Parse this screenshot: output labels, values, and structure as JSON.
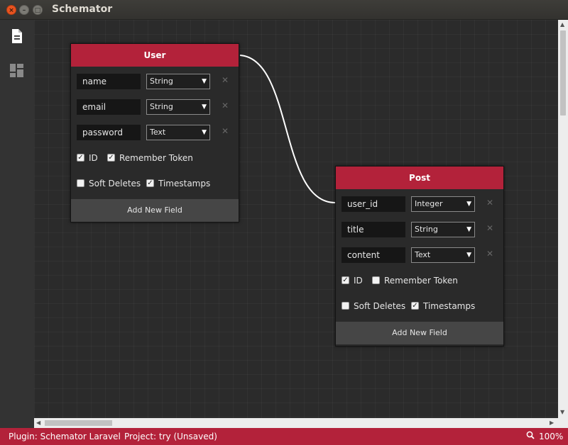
{
  "window": {
    "title": "Schemator",
    "close_glyph": "×",
    "min_glyph": "–",
    "max_glyph": "□"
  },
  "sidebar": {
    "items": [
      {
        "icon": "document-icon"
      },
      {
        "icon": "dashboard-icon"
      }
    ]
  },
  "tables": [
    {
      "name": "User",
      "fields": [
        {
          "name": "name",
          "type": "String"
        },
        {
          "name": "email",
          "type": "String"
        },
        {
          "name": "password",
          "type": "Text"
        }
      ],
      "options": {
        "id": {
          "label": "ID",
          "checked": true
        },
        "remember_token": {
          "label": "Remember Token",
          "checked": true
        },
        "soft_deletes": {
          "label": "Soft Deletes",
          "checked": false
        },
        "timestamps": {
          "label": "Timestamps",
          "checked": true
        }
      },
      "add_label": "Add New Field"
    },
    {
      "name": "Post",
      "fields": [
        {
          "name": "user_id",
          "type": "Integer"
        },
        {
          "name": "title",
          "type": "String"
        },
        {
          "name": "content",
          "type": "Text"
        }
      ],
      "options": {
        "id": {
          "label": "ID",
          "checked": true
        },
        "remember_token": {
          "label": "Remember Token",
          "checked": false
        },
        "soft_deletes": {
          "label": "Soft Deletes",
          "checked": false
        },
        "timestamps": {
          "label": "Timestamps",
          "checked": true
        }
      },
      "add_label": "Add New Field"
    }
  ],
  "glyphs": {
    "caret": "▼",
    "delete": "✕",
    "check": "✓",
    "arrow_up": "▲",
    "arrow_down": "▼",
    "arrow_left": "◀",
    "arrow_right": "▶"
  },
  "status": {
    "plugin": "Plugin: Schemator Laravel",
    "project": "Project: try (Unsaved)",
    "zoom": "100%"
  },
  "colors": {
    "accent": "#b3223a"
  }
}
